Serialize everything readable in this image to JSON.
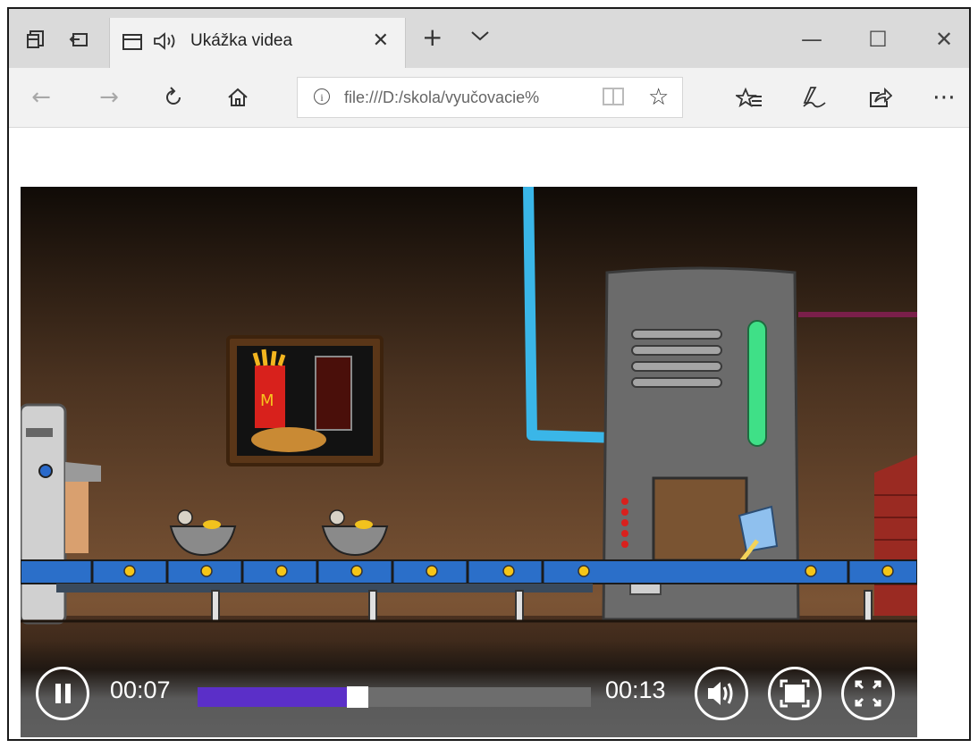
{
  "browser": {
    "tab": {
      "title": "Ukážka videa"
    },
    "address": {
      "url": "file:///D:/skola/vyučovacie%"
    },
    "icons": {
      "set_aside": "tabs-aside-icon",
      "restore": "restore-tabs-icon",
      "page": "page-icon",
      "sound": "speaker-icon",
      "close_tab": "close-icon",
      "new_tab": "plus-icon",
      "tab_list": "chevron-down-icon",
      "back": "back-arrow-icon",
      "forward": "forward-arrow-icon",
      "refresh": "refresh-icon",
      "home": "home-icon",
      "site_info": "info-icon",
      "reading_view": "book-icon",
      "favorite": "star-icon",
      "favorites_hub": "favorites-list-icon",
      "notes": "pen-icon",
      "share": "share-icon",
      "more": "more-icon"
    },
    "window": {
      "minimize": "—",
      "maximize": "☐",
      "close": "✕"
    }
  },
  "video": {
    "current_time": "00:07",
    "duration": "00:13",
    "progress": 0.38,
    "colors": {
      "progress": "#5b2fc8",
      "track": "#6d6d6d"
    }
  }
}
